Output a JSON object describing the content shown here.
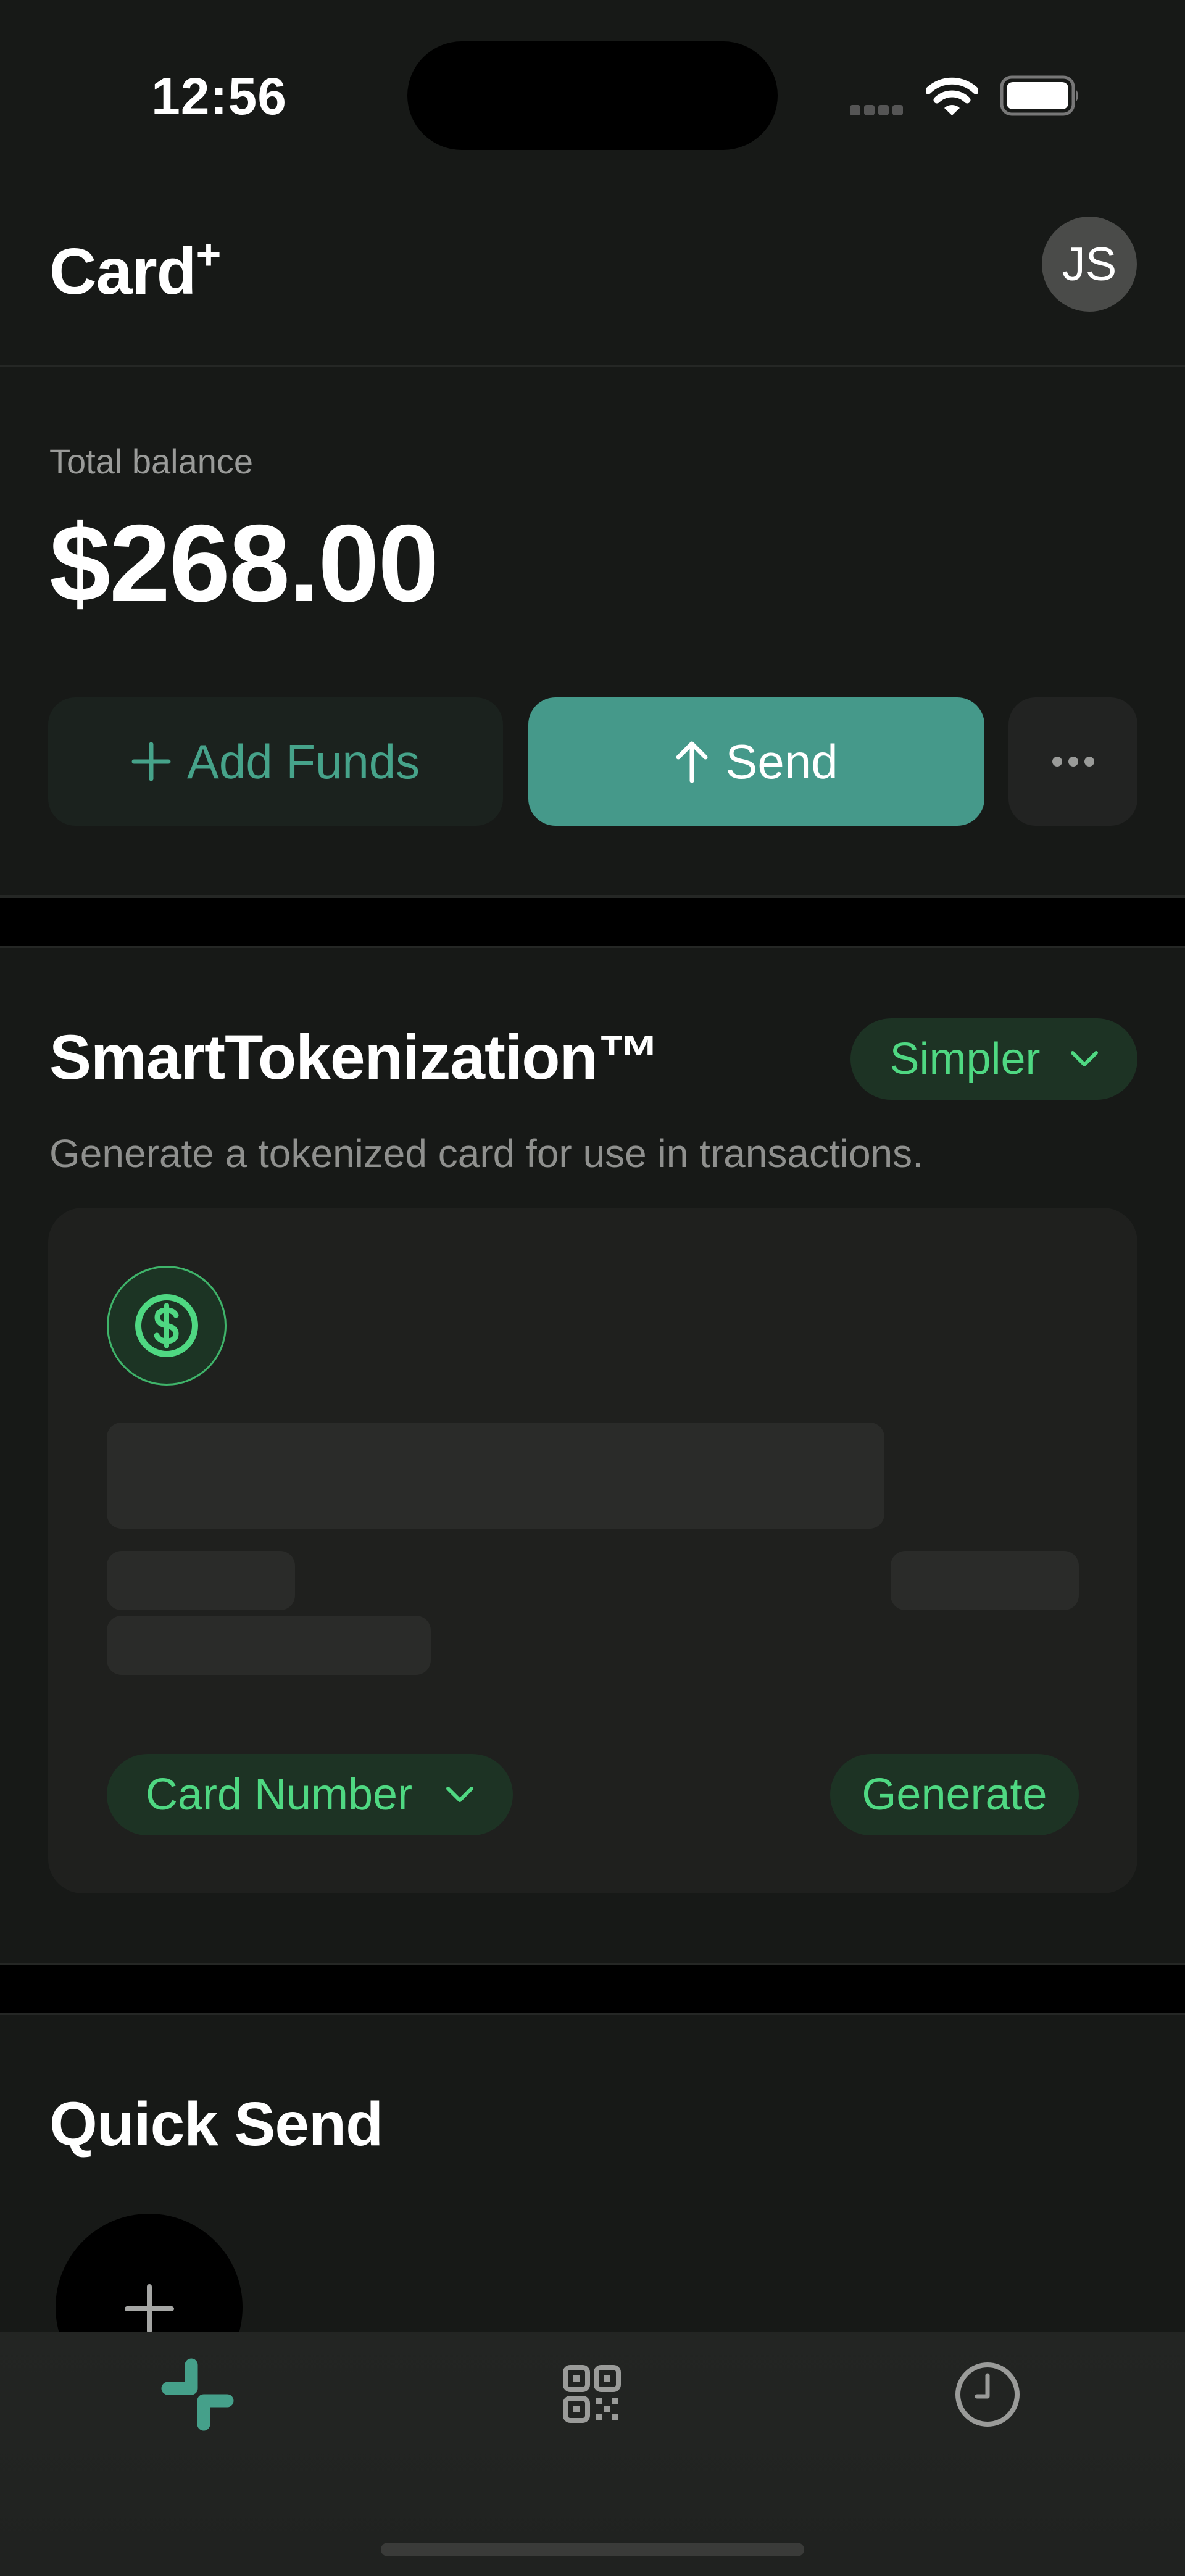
{
  "status_bar": {
    "time": "12:56",
    "signal_icon": "cellular-signal-icon",
    "wifi_icon": "wifi-icon",
    "battery_icon": "battery-icon",
    "battery_level_percent": 100
  },
  "header": {
    "app_name": "Card",
    "app_name_sup": "+",
    "avatar_initials": "JS"
  },
  "balance": {
    "label": "Total balance",
    "value": "$268.00"
  },
  "actions": {
    "add_funds_label": "Add Funds",
    "add_funds_icon": "plus-icon",
    "send_label": "Send",
    "send_icon": "arrow-up-icon",
    "more_icon": "ellipsis-icon"
  },
  "tokenization": {
    "title": "SmartTokenization™",
    "mode_selector": "Simpler",
    "subtitle": "Generate a tokenized card for use in transactions.",
    "card_icon": "dollar-circle-icon",
    "field_selector": "Card Number",
    "generate_label": "Generate"
  },
  "quick_send": {
    "title": "Quick Send",
    "add_icon": "plus-icon"
  },
  "tabbar": {
    "tabs": [
      {
        "icon": "home-logo-icon",
        "active": true
      },
      {
        "icon": "qr-code-icon",
        "active": false
      },
      {
        "icon": "clock-history-icon",
        "active": false
      }
    ]
  },
  "colors": {
    "accent_teal": "#45998a",
    "accent_green": "#4fd882",
    "background": "#171917",
    "card": "#1f201e",
    "muted_text": "#9a9b99"
  }
}
